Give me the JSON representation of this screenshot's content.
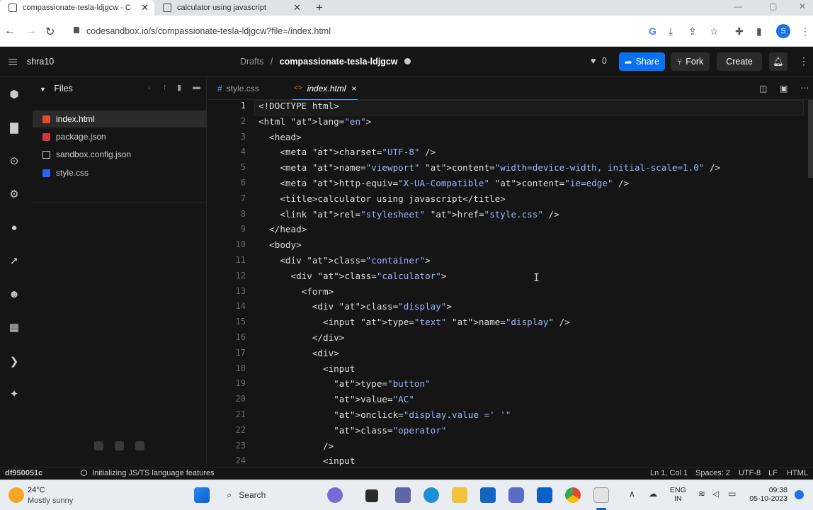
{
  "browser": {
    "tabs": [
      {
        "title": "compassionate-tesla-ldjgcw - C",
        "active": true
      },
      {
        "title": "calculator using javascript",
        "active": false
      }
    ],
    "new_tab": "+",
    "url": "codesandbox.io/s/compassionate-tesla-ldjgcw?file=/index.html",
    "profile_letter": "S"
  },
  "header": {
    "user": "shra10",
    "breadcrumb_parent": "Drafts",
    "breadcrumb_sep": "/",
    "sandbox_name": "compassionate-tesla-ldjgcw",
    "likes": "0",
    "share": "Share",
    "fork": "Fork",
    "create": "Create",
    "accent": "#0971f1"
  },
  "explorer": {
    "title": "Files",
    "files": [
      {
        "name": "index.html",
        "icon": "html5-icon",
        "color": "#e34c26",
        "selected": true
      },
      {
        "name": "package.json",
        "icon": "npm-icon",
        "color": "#cb3837",
        "selected": false
      },
      {
        "name": "sandbox.config.json",
        "icon": "cube-icon",
        "color": "#cccccc",
        "selected": false
      },
      {
        "name": "style.css",
        "icon": "css3-icon",
        "color": "#2965f1",
        "selected": false
      }
    ]
  },
  "editor": {
    "tabs": [
      {
        "label": "style.css",
        "prefix": "#",
        "active": false
      },
      {
        "label": "index.html",
        "prefix": "<>",
        "active": true,
        "close": "×"
      }
    ],
    "lines": [
      "<!DOCTYPE html>",
      "<html lang=\"en\">",
      "  <head>",
      "    <meta charset=\"UTF-8\" />",
      "    <meta name=\"viewport\" content=\"width=device-width, initial-scale=1.0\" />",
      "    <meta http-equiv=\"X-UA-Compatible\" content=\"ie=edge\" />",
      "    <title>calculator using javascript</title>",
      "    <link rel=\"stylesheet\" href=\"style.css\" />",
      "  </head>",
      "  <body>",
      "    <div class=\"container\">",
      "      <div class=\"calculator\">",
      "        <form>",
      "          <div class=\"display\">",
      "            <input type=\"text\" name=\"display\" />",
      "          </div>",
      "          <div>",
      "            <input",
      "              type=\"button\"",
      "              value=\"AC\"",
      "              onclick=\"display.value =' '\"",
      "              class=\"operator\"",
      "            />",
      "            <input"
    ]
  },
  "status": {
    "commit": "df950051c",
    "message": "Initializing JS/TS language features",
    "position": "Ln 1, Col 1",
    "spaces": "Spaces: 2",
    "encoding": "UTF-8",
    "eol": "LF",
    "language": "HTML"
  },
  "taskbar": {
    "temperature": "24°C",
    "weather": "Mostly sunny",
    "search": "Search",
    "lang_top": "ENG",
    "lang_bottom": "IN",
    "time": "09:38",
    "date": "05-10-2023"
  }
}
